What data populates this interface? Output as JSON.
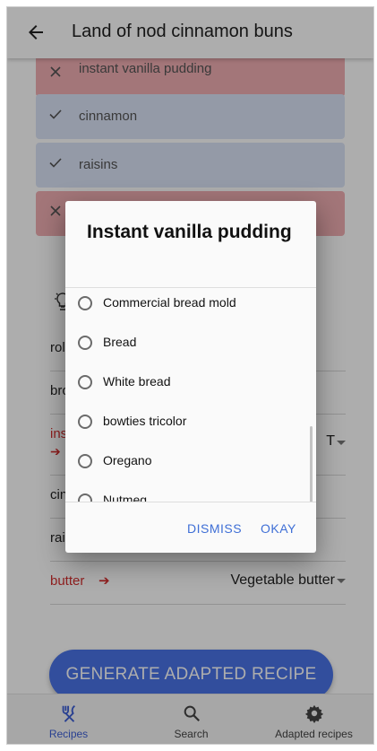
{
  "appbar": {
    "title": "Land of nod cinnamon buns",
    "back_icon": "arrow-left-icon"
  },
  "ingredients": [
    {
      "label": "instant vanilla pudding",
      "status": "missing",
      "icon": "close-icon"
    },
    {
      "label": "cinnamon",
      "status": "available",
      "icon": "check-icon"
    },
    {
      "label": "raisins",
      "status": "available",
      "icon": "check-icon"
    },
    {
      "label": "",
      "status": "missing",
      "icon": "close-icon"
    }
  ],
  "substitutions": [
    {
      "name": "roll",
      "selected": ""
    },
    {
      "name": "bro",
      "selected": ""
    },
    {
      "name": "ins",
      "selected": "T",
      "missing": true
    },
    {
      "name": "cin",
      "selected": ""
    },
    {
      "name": "rais",
      "selected": ""
    },
    {
      "name": "butter",
      "selected": "Vegetable butter",
      "missing": true
    }
  ],
  "generate_button": "GENERATE ADAPTED RECIPE",
  "bottom_nav": [
    {
      "label": "Recipes",
      "icon": "fork-knife-icon",
      "active": true
    },
    {
      "label": "Search",
      "icon": "search-icon",
      "active": false
    },
    {
      "label": "Adapted recipes",
      "icon": "gear-icon",
      "active": false
    }
  ],
  "dialog": {
    "title": "Instant vanilla pudding",
    "options": [
      "Commercial bread mold",
      "Bread",
      "White bread",
      "bowties tricolor",
      "Oregano",
      "Nutmeg"
    ],
    "dismiss_label": "DISMISS",
    "okay_label": "OKAY"
  },
  "colors": {
    "missing_bg": "#f1aeb3",
    "available_bg": "#dbe3f6",
    "accent": "#4a74e8",
    "missing_text": "#d32f2f"
  }
}
